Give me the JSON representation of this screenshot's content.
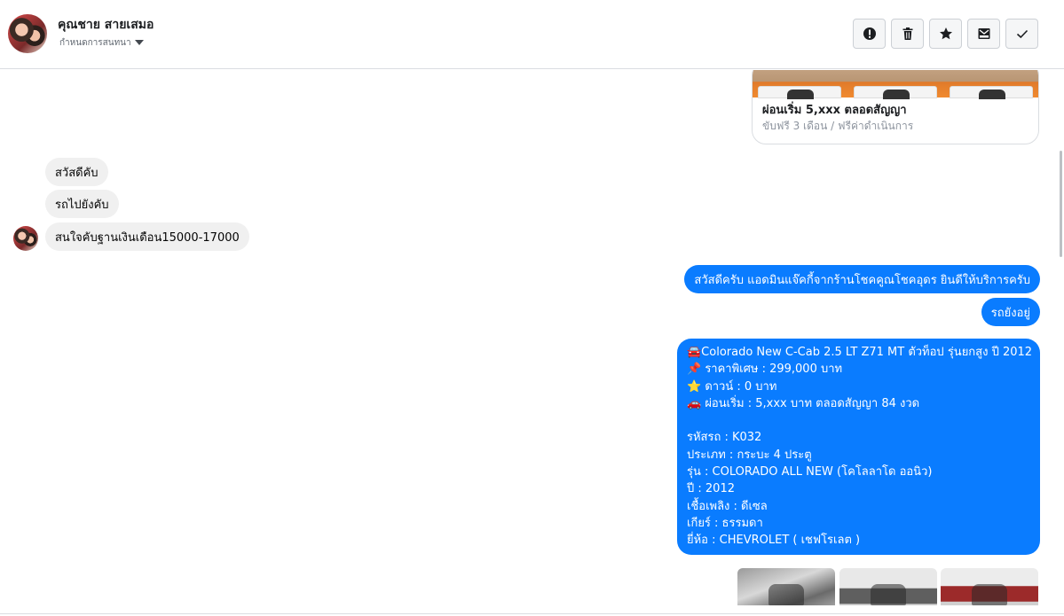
{
  "header": {
    "contact_name": "คุณชาย สายเสมอ",
    "subtitle": "กำหนดการสนทนา",
    "actions": [
      {
        "name": "report-button",
        "icon": "exclamation-icon"
      },
      {
        "name": "delete-button",
        "icon": "trash-icon"
      },
      {
        "name": "star-button",
        "icon": "star-icon"
      },
      {
        "name": "mark-unread-button",
        "icon": "envelope-icon"
      },
      {
        "name": "mark-done-button",
        "icon": "check-icon"
      }
    ]
  },
  "ad_card": {
    "title": "ผ่อนเริ่ม 5,xxx ตลอดสัญญา",
    "subtitle": "ขับฟรี 3 เดือน / ฟรีค่าดำเนินการ"
  },
  "incoming": [
    "สวัสดีคับ",
    "รถไปยังคับ",
    "สนใจคับฐานเงินเดือน15000-17000"
  ],
  "outgoing": {
    "greeting": "สวัสดีครับ แอดมินแจ๊คกี้จากร้านโชคคูณโชคอุดร ยินดีให้บริการครับ",
    "available": "รถยังอยู่",
    "details": [
      "🚘Colorado New C-Cab 2.5 LT Z71 MT ตัวท็อป รุ่นยกสูง ปี 2012",
      "📌 ราคาพิเศษ : 299,000 บาท",
      "⭐ ดาวน์ : 0 บาท",
      "🚗 ผ่อนเริ่ม : 5,xxx บาท ตลอดสัญญา 84 งวด",
      "",
      "รหัสรถ : K032",
      "ประเภท : กระบะ 4 ประตู",
      "รุ่น : COLORADO ALL NEW (โคโลลาโด ออนิว)",
      "ปี : 2012",
      "เชื้อเพลิง : ดีเซล",
      "เกียร์ : ธรรมดา",
      "ยี่ห้อ : CHEVROLET ( เชฟโรเลต )"
    ]
  },
  "colors": {
    "outgoing_bubble": "#0a7cff",
    "incoming_bubble": "#f0f0f0",
    "border": "#dadde1"
  }
}
